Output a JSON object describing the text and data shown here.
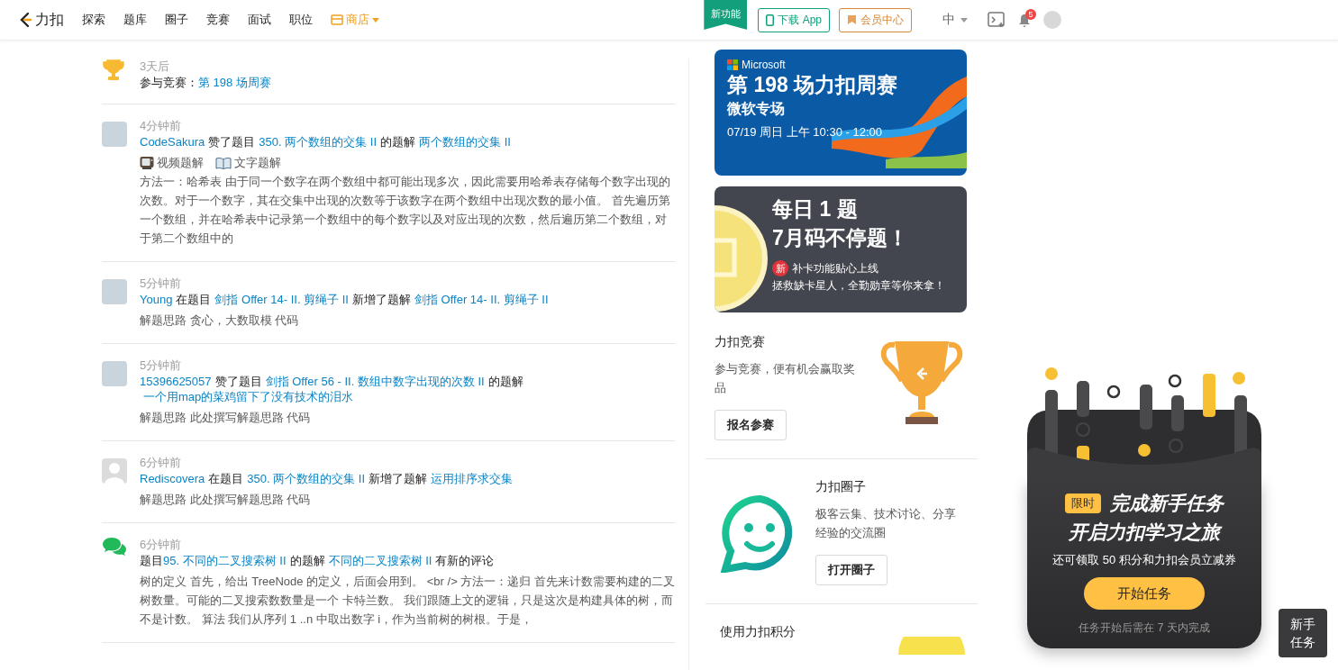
{
  "navbar": {
    "brand": "力扣",
    "items": [
      {
        "label": "探索",
        "selected": false
      },
      {
        "label": "题库",
        "selected": false
      },
      {
        "label": "圈子",
        "selected": false
      },
      {
        "label": "竞赛",
        "selected": false
      },
      {
        "label": "面试",
        "selected": false
      },
      {
        "label": "职位",
        "selected": false
      }
    ],
    "store": {
      "label": "商店"
    },
    "new_badge": "新功能",
    "download_button": "下载 App",
    "vip_button": "会员中心",
    "language": "中",
    "notification_count": "5"
  },
  "feed": [
    {
      "kind": "trophy",
      "time": "3天后",
      "headline": [
        {
          "kind": "text",
          "text": "参与竞赛："
        },
        {
          "kind": "link",
          "text": "第 198 场周赛"
        }
      ]
    },
    {
      "kind": "avatar",
      "time": "4分钟前",
      "headline": [
        {
          "kind": "link",
          "text": "CodeSakura"
        },
        {
          "kind": "text",
          "text": "赞了题目"
        },
        {
          "kind": "link",
          "text": "350. 两个数组的交集 II"
        },
        {
          "kind": "text",
          "text": "的题解"
        },
        {
          "kind": "link",
          "text": "两个数组的交集 II"
        }
      ],
      "badges": [
        {
          "kind": "video",
          "label": "视频题解"
        },
        {
          "kind": "book",
          "label": "文字题解"
        }
      ],
      "body": "方法一：哈希表 由于同一个数字在两个数组中都可能出现多次，因此需要用哈希表存储每个数字出现的次数。对于一个数字，其在交集中出现的次数等于该数字在两个数组中出现次数的最小值。 首先遍历第一个数组，并在哈希表中记录第一个数组中的每个数字以及对应出现的次数，然后遍历第二个数组，对于第二个数组中的"
    },
    {
      "kind": "avatar",
      "time": "5分钟前",
      "headline": [
        {
          "kind": "link",
          "text": "Young"
        },
        {
          "kind": "text",
          "text": "在题目"
        },
        {
          "kind": "link",
          "text": "剑指 Offer 14- II. 剪绳子 II"
        },
        {
          "kind": "text",
          "text": "新增了题解"
        },
        {
          "kind": "link",
          "text": "剑指 Offer 14- II. 剪绳子 II"
        }
      ],
      "body": "解题思路 贪心，大数取模 代码"
    },
    {
      "kind": "avatar",
      "time": "5分钟前",
      "headline": [
        {
          "kind": "link",
          "text": "15396625057"
        },
        {
          "kind": "text",
          "text": "赞了题目"
        },
        {
          "kind": "link",
          "text": "剑指 Offer 56 - II. 数组中数字出现的次数 II"
        },
        {
          "kind": "text",
          "text": "的题解"
        },
        {
          "kind": "link",
          "text": "一个用map的菜鸡留下了没有技术的泪水"
        }
      ],
      "body": "解题思路 此处撰写解题思路 代码"
    },
    {
      "kind": "default-avatar",
      "time": "6分钟前",
      "headline": [
        {
          "kind": "link",
          "text": "Rediscovera"
        },
        {
          "kind": "text",
          "text": "在题目"
        },
        {
          "kind": "link",
          "text": "350. 两个数组的交集 II"
        },
        {
          "kind": "text",
          "text": "新增了题解"
        },
        {
          "kind": "link",
          "text": "运用排序求交集"
        }
      ],
      "body": "解题思路 此处撰写解题思路 代码"
    },
    {
      "kind": "chat",
      "time": "6分钟前",
      "headline": [
        {
          "kind": "text",
          "text": "题目"
        },
        {
          "kind": "link",
          "text": "95. 不同的二叉搜索树 II"
        },
        {
          "kind": "text",
          "text": "的题解"
        },
        {
          "kind": "link",
          "text": "不同的二叉搜索树 II"
        },
        {
          "kind": "text",
          "text": "有新的评论"
        }
      ],
      "body": "树的定义 首先，给出 TreeNode 的定义，后面会用到。 <br /> 方法一：递归 首先来计数需要构建的二叉树数量。可能的二叉搜索数数量是一个 卡特兰数。 我们跟随上文的逻辑，只是这次是构建具体的树，而不是计数。 算法 我们从序列 1 ..n 中取出数字 i，作为当前树的树根。于是，"
    }
  ],
  "banners": [
    {
      "kind": "contest",
      "brand": "Microsoft",
      "title": "第 198 场力扣周赛",
      "subtitle": "微软专场",
      "date": "07/19 周日  上午 10:30 - 12:00"
    },
    {
      "kind": "daily",
      "title": "每日 1 题",
      "subtitle": "7月码不停题！",
      "tag": "新",
      "note": "补卡功能贴心上线",
      "date": "拯救缺卡星人，全勤勋章等你来拿！"
    }
  ],
  "cards": [
    {
      "kind": "contest",
      "title": "力扣竞赛",
      "description": "参与竞赛，便有机会赢取奖品",
      "button": "报名参赛"
    },
    {
      "kind": "circle",
      "title": "力扣圈子",
      "description": "极客云集、技术讨论、分享经验的交流圈",
      "button": "打开圈子"
    },
    {
      "kind": "points",
      "title": "使用力扣积分"
    }
  ],
  "task_popup": {
    "badge": "限时",
    "title": "完成新手任务",
    "subtitle": "开启力扣学习之旅",
    "reward": "还可领取 50 积分和力扣会员立减券",
    "button": "开始任务",
    "note": "任务开始后需在 7 天内完成"
  },
  "task_button": "新手任务"
}
